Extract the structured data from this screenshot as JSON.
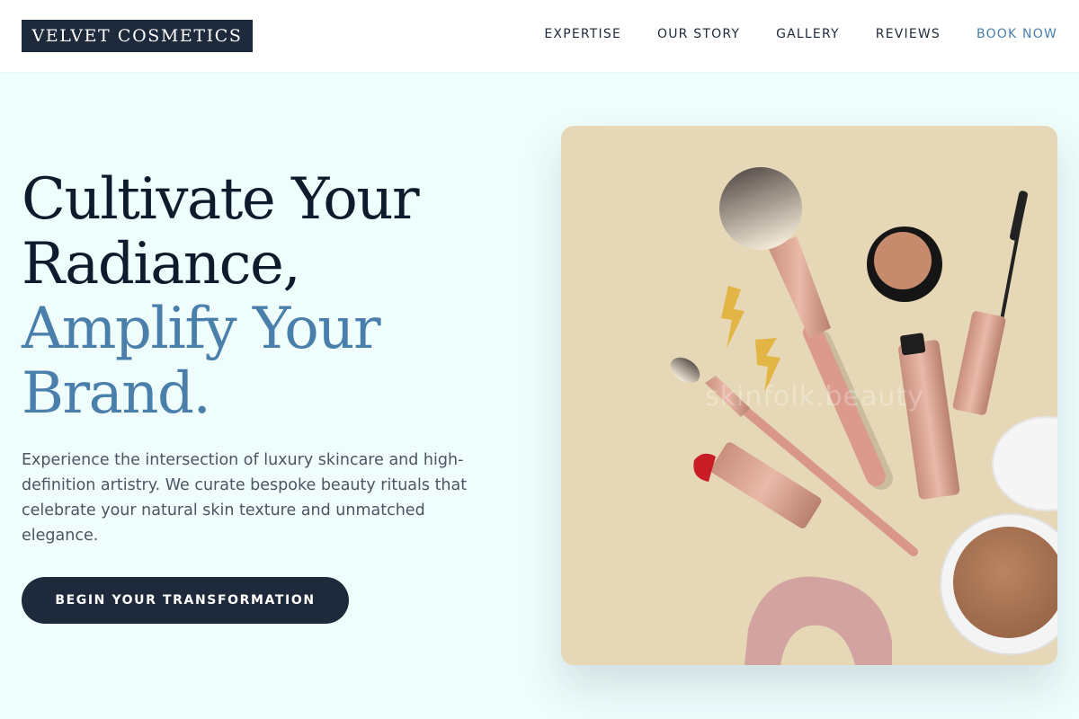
{
  "brand": {
    "name": "VELVET COSMETICS"
  },
  "nav": {
    "items": [
      {
        "label": "EXPERTISE"
      },
      {
        "label": "OUR STORY"
      },
      {
        "label": "GALLERY"
      },
      {
        "label": "REVIEWS"
      },
      {
        "label": "BOOK NOW"
      }
    ]
  },
  "hero": {
    "headline_line1": "Cultivate Your",
    "headline_line2": "Radiance,",
    "headline_accent_line1": "Amplify Your",
    "headline_accent_line2": "Brand.",
    "description": "Experience the intersection of luxury skincare and high-definition artistry. We curate bespoke beauty rituals that celebrate your natural skin texture and unmatched elegance.",
    "cta_label": "BEGIN YOUR TRANSFORMATION",
    "image_watermark": "skinfolk.beauty"
  },
  "colors": {
    "background": "#effdfd",
    "navy": "#1e293b",
    "accent_blue": "#4a7fac",
    "image_background": "#e6d8b6"
  }
}
